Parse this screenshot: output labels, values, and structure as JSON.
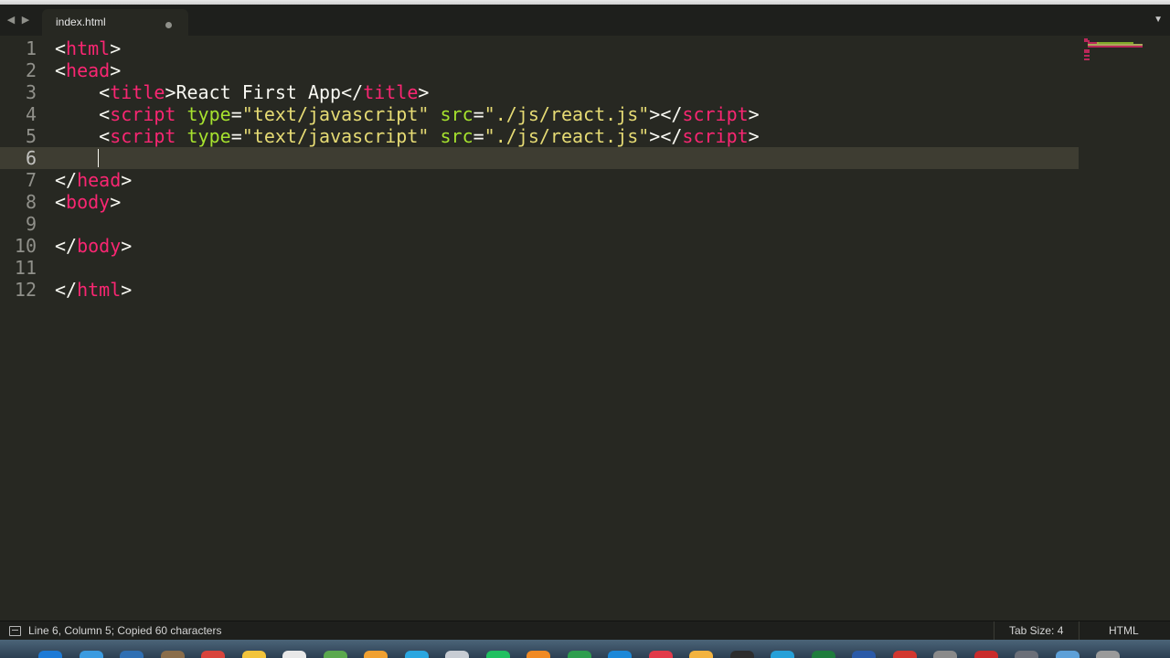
{
  "tab": {
    "title": "index.html"
  },
  "editor": {
    "current_line": 6,
    "lines": [
      {
        "number": "1",
        "tokens": [
          [
            "p",
            "<"
          ],
          [
            "t",
            "html"
          ],
          [
            "p",
            ">"
          ]
        ]
      },
      {
        "number": "2",
        "tokens": [
          [
            "p",
            "<"
          ],
          [
            "t",
            "head"
          ],
          [
            "p",
            ">"
          ]
        ]
      },
      {
        "number": "3",
        "tokens": [
          [
            "p",
            "    <"
          ],
          [
            "t",
            "title"
          ],
          [
            "p",
            ">React First App</"
          ],
          [
            "t",
            "title"
          ],
          [
            "p",
            ">"
          ]
        ]
      },
      {
        "number": "4",
        "tokens": [
          [
            "p",
            "    <"
          ],
          [
            "t",
            "script"
          ],
          [
            "p",
            " "
          ],
          [
            "a",
            "type"
          ],
          [
            "p",
            "="
          ],
          [
            "s",
            "\"text/javascript\""
          ],
          [
            "p",
            " "
          ],
          [
            "a",
            "src"
          ],
          [
            "p",
            "="
          ],
          [
            "s",
            "\"./js/react.js\""
          ],
          [
            "p",
            "></"
          ],
          [
            "t",
            "script"
          ],
          [
            "p",
            ">"
          ]
        ]
      },
      {
        "number": "5",
        "tokens": [
          [
            "p",
            "    <"
          ],
          [
            "t",
            "script"
          ],
          [
            "p",
            " "
          ],
          [
            "a",
            "type"
          ],
          [
            "p",
            "="
          ],
          [
            "s",
            "\"text/javascript\""
          ],
          [
            "p",
            " "
          ],
          [
            "a",
            "src"
          ],
          [
            "p",
            "="
          ],
          [
            "s",
            "\"./js/react.js\""
          ],
          [
            "p",
            "></"
          ],
          [
            "t",
            "script"
          ],
          [
            "p",
            ">"
          ]
        ]
      },
      {
        "number": "6",
        "tokens": []
      },
      {
        "number": "7",
        "tokens": [
          [
            "p",
            "</"
          ],
          [
            "t",
            "head"
          ],
          [
            "p",
            ">"
          ]
        ]
      },
      {
        "number": "8",
        "tokens": [
          [
            "p",
            "<"
          ],
          [
            "t",
            "body"
          ],
          [
            "p",
            ">"
          ]
        ]
      },
      {
        "number": "9",
        "tokens": []
      },
      {
        "number": "10",
        "tokens": [
          [
            "p",
            "</"
          ],
          [
            "t",
            "body"
          ],
          [
            "p",
            ">"
          ]
        ]
      },
      {
        "number": "11",
        "tokens": []
      },
      {
        "number": "12",
        "tokens": [
          [
            "p",
            "</"
          ],
          [
            "t",
            "html"
          ],
          [
            "p",
            ">"
          ]
        ]
      }
    ]
  },
  "status": {
    "message": "Line 6, Column 5; Copied 60 characters",
    "tab_size": "Tab Size: 4",
    "syntax": "HTML"
  },
  "colors": {
    "background": "#272822",
    "tag": "#f92672",
    "attribute": "#a6e22e",
    "string": "#e6db74",
    "text": "#f8f8f2"
  }
}
